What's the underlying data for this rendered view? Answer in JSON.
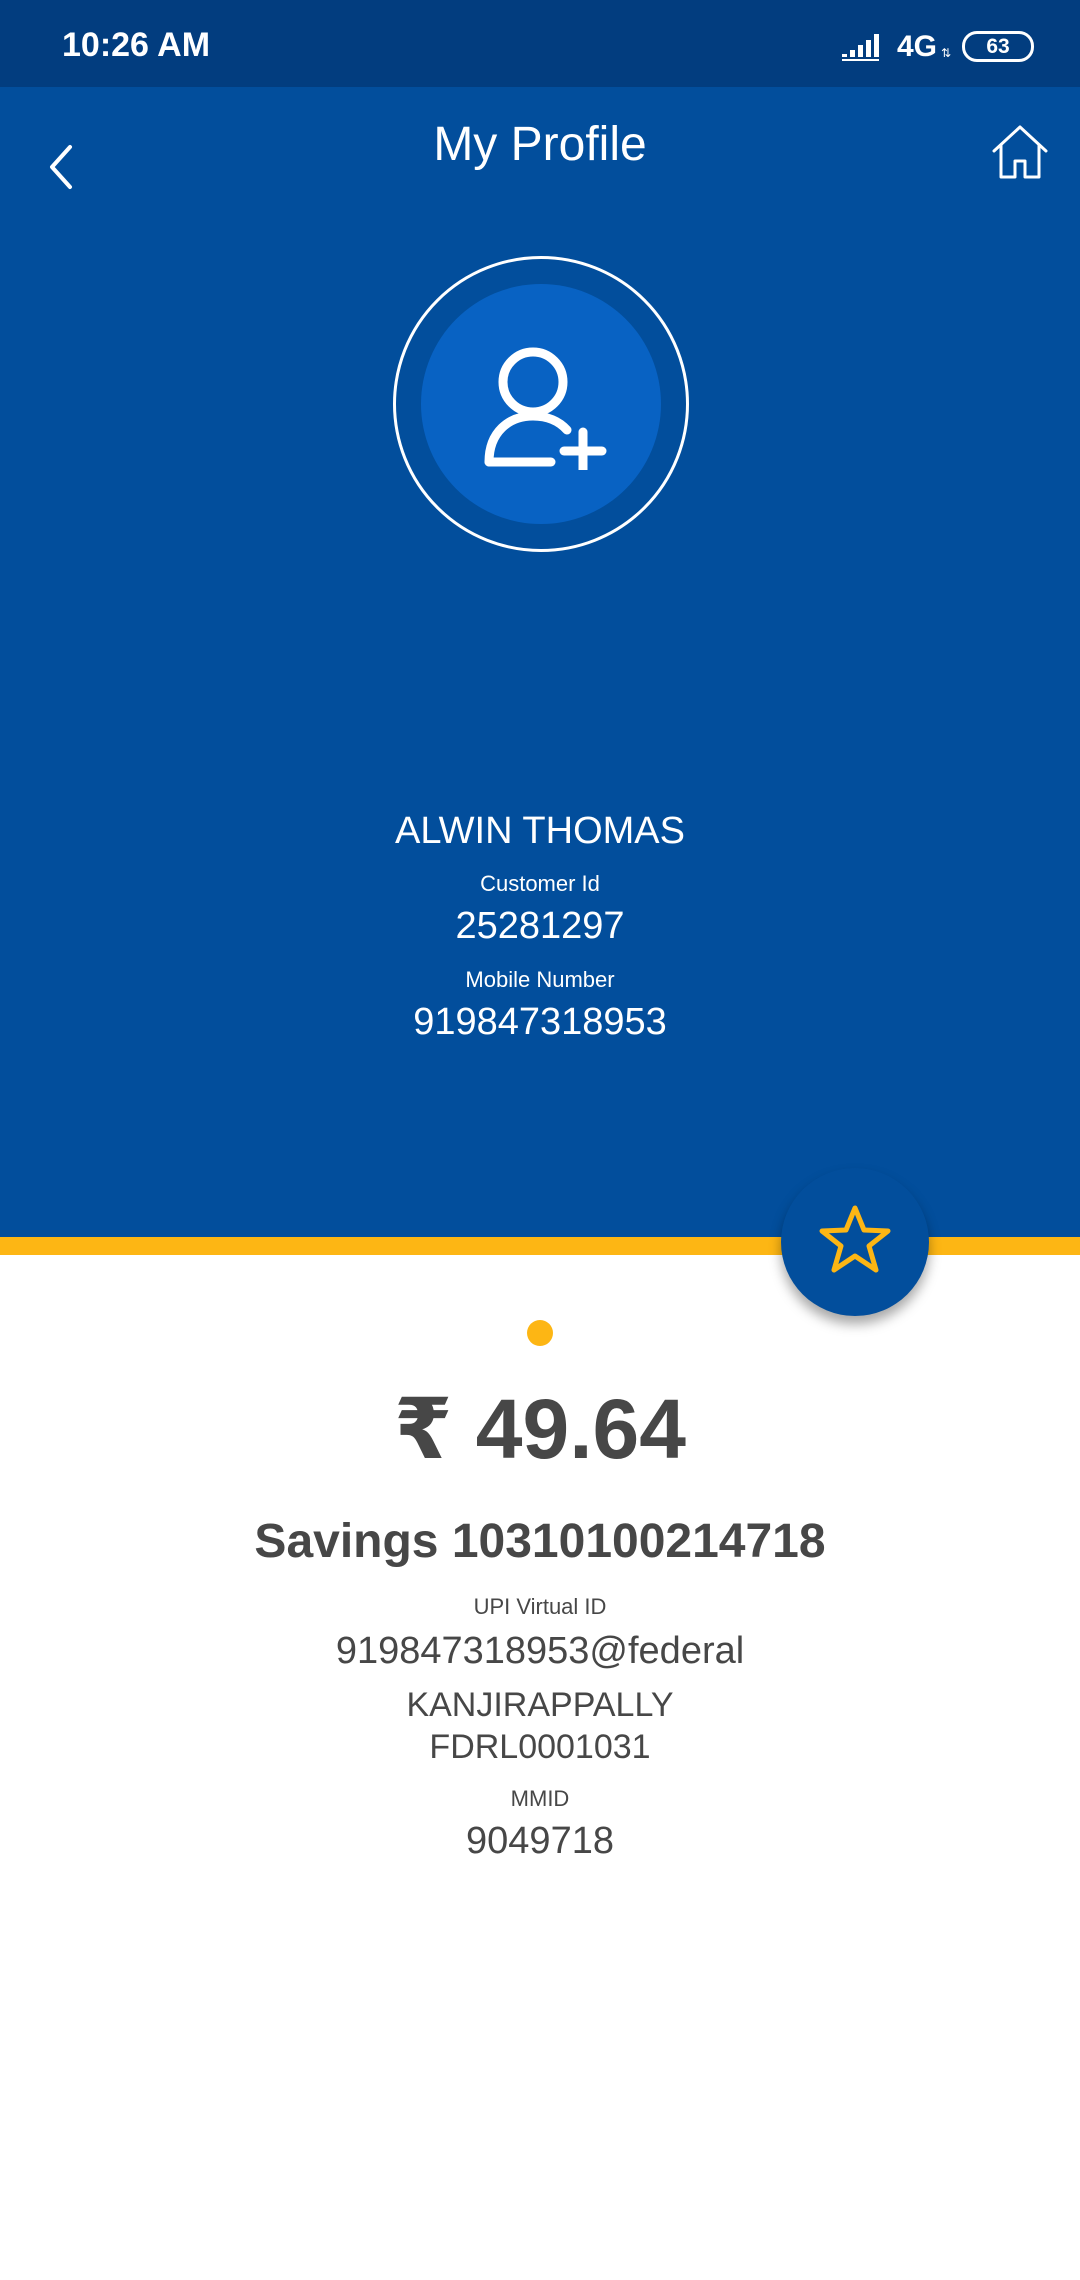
{
  "status_bar": {
    "time": "10:26 AM",
    "network": "4G",
    "battery": "63",
    "icons": [
      "signal-icon",
      "battery-icon"
    ]
  },
  "header": {
    "title": "My Profile",
    "back_icon": "chevron-left-icon",
    "home_icon": "home-icon",
    "avatar_icon": "add-user-icon"
  },
  "profile": {
    "name": "ALWIN THOMAS",
    "customer_id_label": "Customer Id",
    "customer_id": "25281297",
    "mobile_label": "Mobile Number",
    "mobile": "919847318953"
  },
  "account": {
    "balance": "₹ 49.64",
    "account_line": "Savings 10310100214718",
    "upi_label": "UPI Virtual ID",
    "upi_id": "919847318953@federal",
    "branch": "KANJIRAPPALLY",
    "ifsc": "FDRL0001031",
    "mmid_label": "MMID",
    "mmid": "9049718",
    "favorite_icon": "star-icon"
  },
  "colors": {
    "primary": "#024e9c",
    "status_bar": "#023d7f",
    "accent": "#fdb614",
    "text_dark": "#474747"
  }
}
